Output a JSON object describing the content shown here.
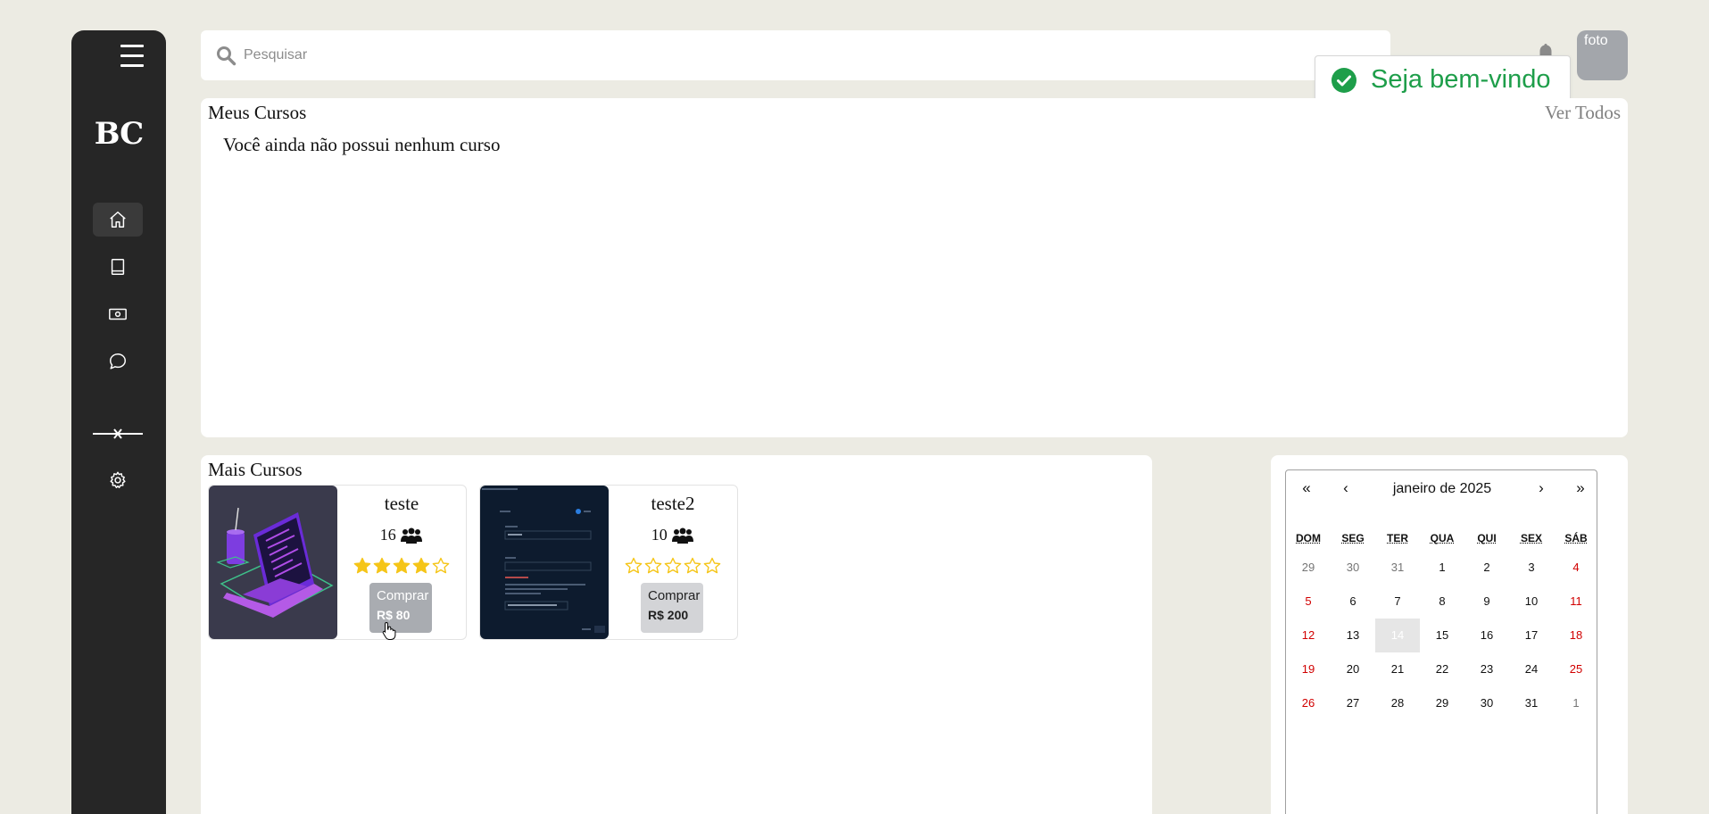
{
  "sidebar": {
    "logo": "BC",
    "nav": [
      {
        "name": "home",
        "active": true
      },
      {
        "name": "book"
      },
      {
        "name": "money"
      },
      {
        "name": "chat"
      }
    ]
  },
  "search": {
    "placeholder": "Pesquisar"
  },
  "avatar": {
    "alt": "foto"
  },
  "toast": {
    "message": "Seja bem-vindo",
    "color": "#1e9e4a"
  },
  "my_courses": {
    "title": "Meus Cursos",
    "view_all": "Ver Todos",
    "empty_message": "Você ainda não possui nenhum curso"
  },
  "more_courses": {
    "title": "Mais Cursos",
    "items": [
      {
        "name": "teste",
        "students": "16",
        "rating": 4,
        "buy_label": "Comprar",
        "price": "R$ 80"
      },
      {
        "name": "teste2",
        "students": "10",
        "rating": 0,
        "buy_label": "Comprar",
        "price": "R$ 200"
      }
    ]
  },
  "calendar": {
    "nav": {
      "prev_year": "«",
      "prev_month": "‹",
      "next_month": "›",
      "next_year": "»"
    },
    "month_label": "janeiro de 2025",
    "weekdays": [
      "DOM",
      "SEG",
      "TER",
      "QUA",
      "QUI",
      "SEX",
      "SÁB"
    ],
    "weeks": [
      [
        "29",
        "30",
        "31",
        "1",
        "2",
        "3",
        "4"
      ],
      [
        "5",
        "6",
        "7",
        "8",
        "9",
        "10",
        "11"
      ],
      [
        "12",
        "13",
        "14",
        "15",
        "16",
        "17",
        "18"
      ],
      [
        "19",
        "20",
        "21",
        "22",
        "23",
        "24",
        "25"
      ],
      [
        "26",
        "27",
        "28",
        "29",
        "30",
        "31",
        "1"
      ]
    ],
    "today": "14",
    "weekend_color": "#d10000"
  }
}
